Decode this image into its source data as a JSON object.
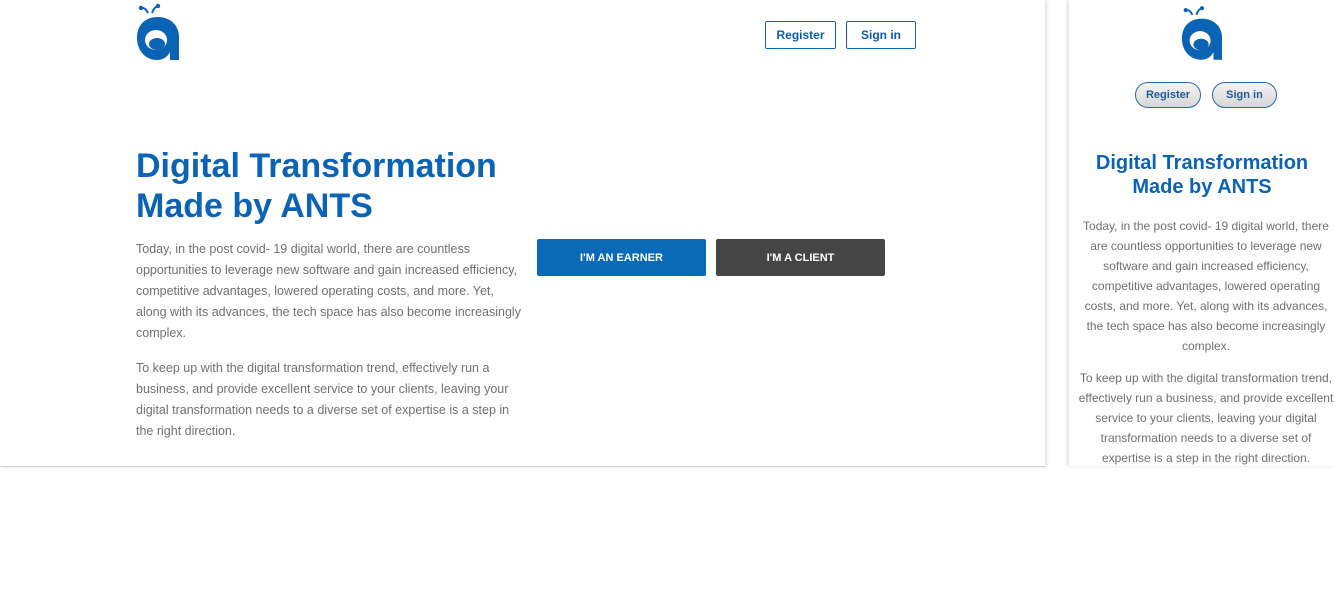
{
  "desktop": {
    "header": {
      "register_label": "Register",
      "signin_label": "Sign in"
    },
    "hero": {
      "title_line1": "Digital Transformation",
      "title_line2": "Made by ANTS",
      "paragraph1": "Today, in the post covid- 19 digital world, there are countless opportunities to leverage new software and gain increased efficiency, competitive advantages, lowered operating costs, and more. Yet, along with its advances, the tech space has also become increasingly complex.",
      "paragraph2": "To keep up with the digital transformation trend, effectively run a business, and provide excellent service to your clients, leaving your digital transformation needs to a diverse set of expertise is a step in the right direction."
    },
    "cta": {
      "earner_label": "I'M AN EARNER",
      "client_label": "I'M A CLIENT"
    }
  },
  "mobile": {
    "header": {
      "register_label": "Register",
      "signin_label": "Sign in"
    },
    "hero": {
      "title_line1": "Digital Transformation",
      "title_line2": "Made by ANTS",
      "paragraph1": "Today, in the post covid- 19 digital world, there are countless opportunities to leverage new software and gain increased efficiency, competitive advantages, lowered operating costs, and more. Yet, along with its advances, the tech space has also become increasingly complex.",
      "paragraph2": "To keep up with the digital transformation trend, effectively run a business, and provide excellent service to your clients, leaving your digital transformation needs to a diverse set of expertise is a step in the right direction."
    }
  },
  "brand": {
    "logo_icon": "ant-letter-a-logo",
    "primary_color": "#0b63b5",
    "client_button_color": "#454545",
    "earner_button_color": "#0a6ab8"
  }
}
